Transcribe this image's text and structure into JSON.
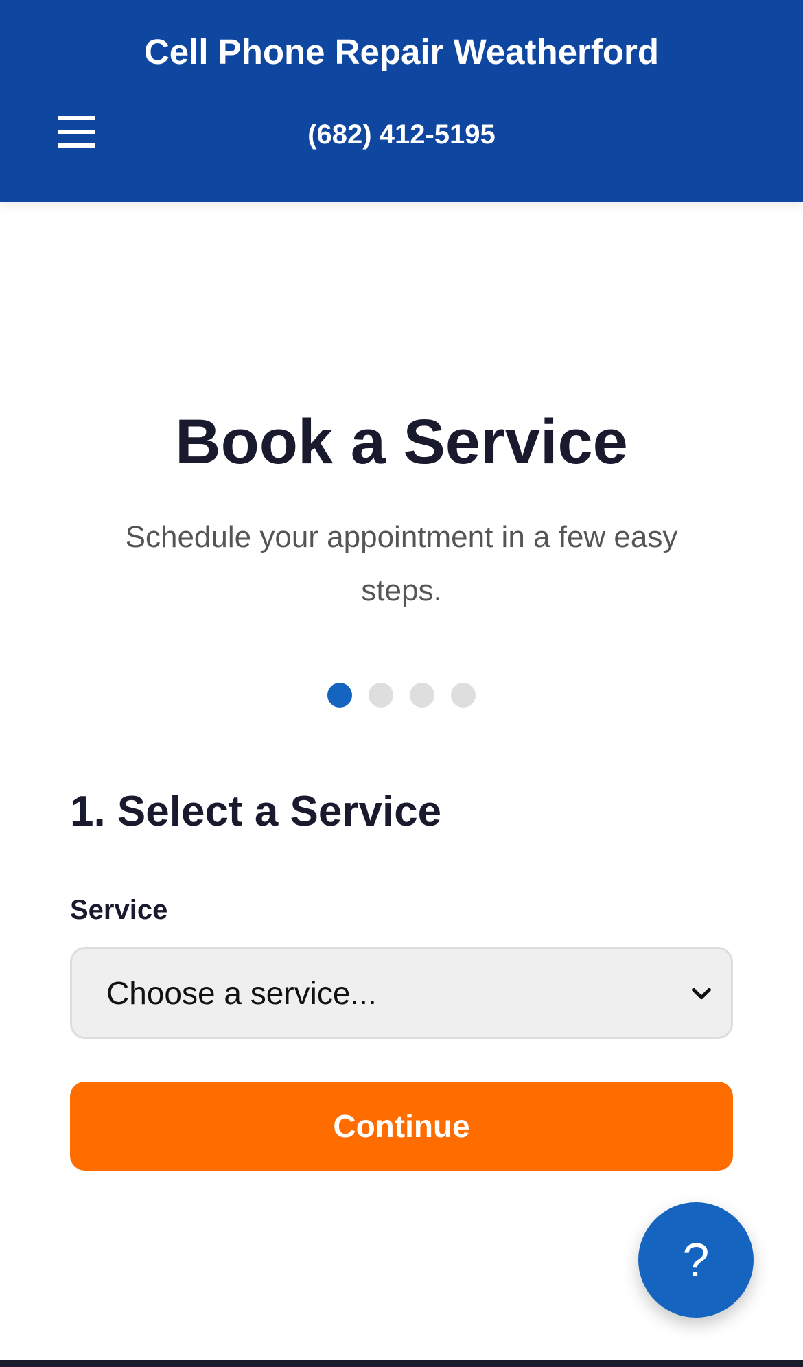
{
  "header": {
    "site_title": "Cell Phone Repair Weatherford",
    "phone": "(682) 412-5195",
    "menu_icon": "hamburger-menu-icon",
    "background_color": "#0f47a0"
  },
  "main": {
    "title": "Book a Service",
    "subtitle": "Schedule your appointment in a few easy steps.",
    "steps": {
      "total": 4,
      "current": 1
    },
    "section_title": "1. Select a Service",
    "service_field": {
      "label": "Service",
      "selected_value": "Choose a service..."
    },
    "continue_label": "Continue"
  },
  "help_button": {
    "label": "?",
    "color": "#1565c0"
  },
  "colors": {
    "accent": "#ff6d00",
    "primary": "#1565c0",
    "heading": "#191a2e"
  }
}
